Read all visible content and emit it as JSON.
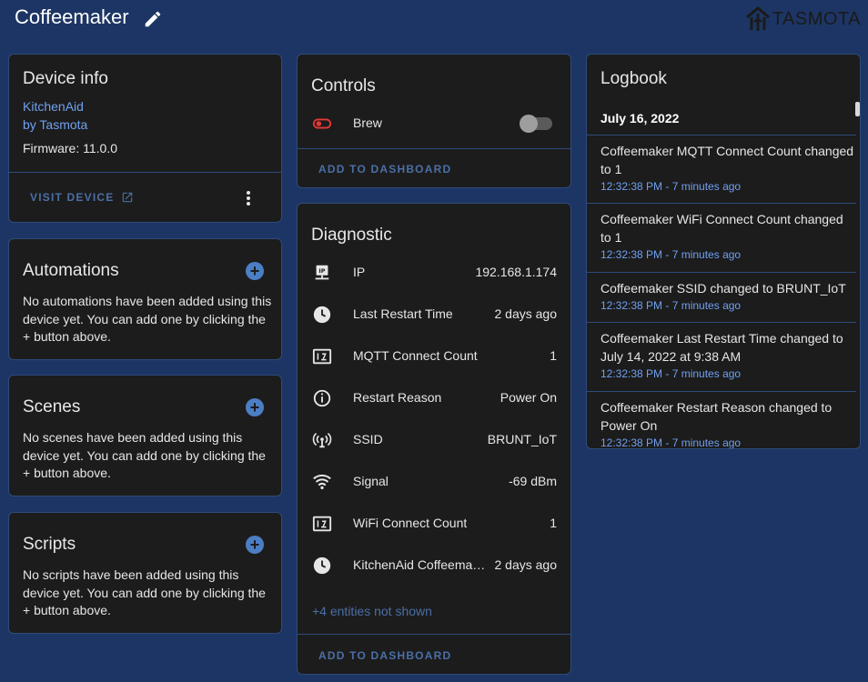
{
  "header": {
    "title": "Coffeemaker",
    "brand": "TASMOTA"
  },
  "device_info": {
    "title": "Device info",
    "model": "KitchenAid",
    "manufacturer": "by Tasmota",
    "firmware": "Firmware: 11.0.0",
    "visit_label": "VISIT DEVICE"
  },
  "automations": {
    "title": "Automations",
    "text": "No automations have been added using this device yet. You can add one by clicking the + button above."
  },
  "scenes": {
    "title": "Scenes",
    "text": "No scenes have been added using this device yet. You can add one by clicking the + button above."
  },
  "scripts": {
    "title": "Scripts",
    "text": "No scripts have been added using this device yet. You can add one by clicking the + button above."
  },
  "controls": {
    "title": "Controls",
    "entity": "Brew",
    "toggle_state": "off",
    "add_label": "ADD TO DASHBOARD"
  },
  "diagnostic": {
    "title": "Diagnostic",
    "entities": [
      {
        "icon": "ip-network-icon",
        "name": "IP",
        "value": "192.168.1.174"
      },
      {
        "icon": "clock-icon",
        "name": "Last Restart Time",
        "value": "2 days ago"
      },
      {
        "icon": "counter-icon",
        "name": "MQTT Connect Count",
        "value": "1"
      },
      {
        "icon": "info-icon",
        "name": "Restart Reason",
        "value": "Power On"
      },
      {
        "icon": "access-point-icon",
        "name": "SSID",
        "value": "BRUNT_IoT"
      },
      {
        "icon": "wifi-icon",
        "name": "Signal",
        "value": "-69 dBm"
      },
      {
        "icon": "counter-icon",
        "name": "WiFi Connect Count",
        "value": "1"
      },
      {
        "icon": "clock-icon",
        "name": "KitchenAid Coffeemake…",
        "value": "2 days ago"
      }
    ],
    "more": "+4 entities not shown",
    "add_label": "ADD TO DASHBOARD"
  },
  "logbook": {
    "title": "Logbook",
    "date": "July 16, 2022",
    "entries": [
      {
        "message": "Coffeemaker MQTT Connect Count changed to 1",
        "time": "12:32:38 PM - 7 minutes ago"
      },
      {
        "message": "Coffeemaker WiFi Connect Count changed to 1",
        "time": "12:32:38 PM - 7 minutes ago"
      },
      {
        "message": "Coffeemaker SSID changed to BRUNT_IoT",
        "time": "12:32:38 PM - 7 minutes ago"
      },
      {
        "message": "Coffeemaker Last Restart Time changed to July 14, 2022 at 9:38 AM",
        "time": "12:32:38 PM - 7 minutes ago"
      },
      {
        "message": "Coffeemaker Restart Reason changed to Power On",
        "time": "12:32:38 PM - 7 minutes ago"
      }
    ]
  },
  "colors": {
    "background": "#1c3564",
    "card": "#1c1c1c",
    "accent": "#4b7ec4",
    "link": "#6fa0f0",
    "switch_icon": "#e53935"
  }
}
